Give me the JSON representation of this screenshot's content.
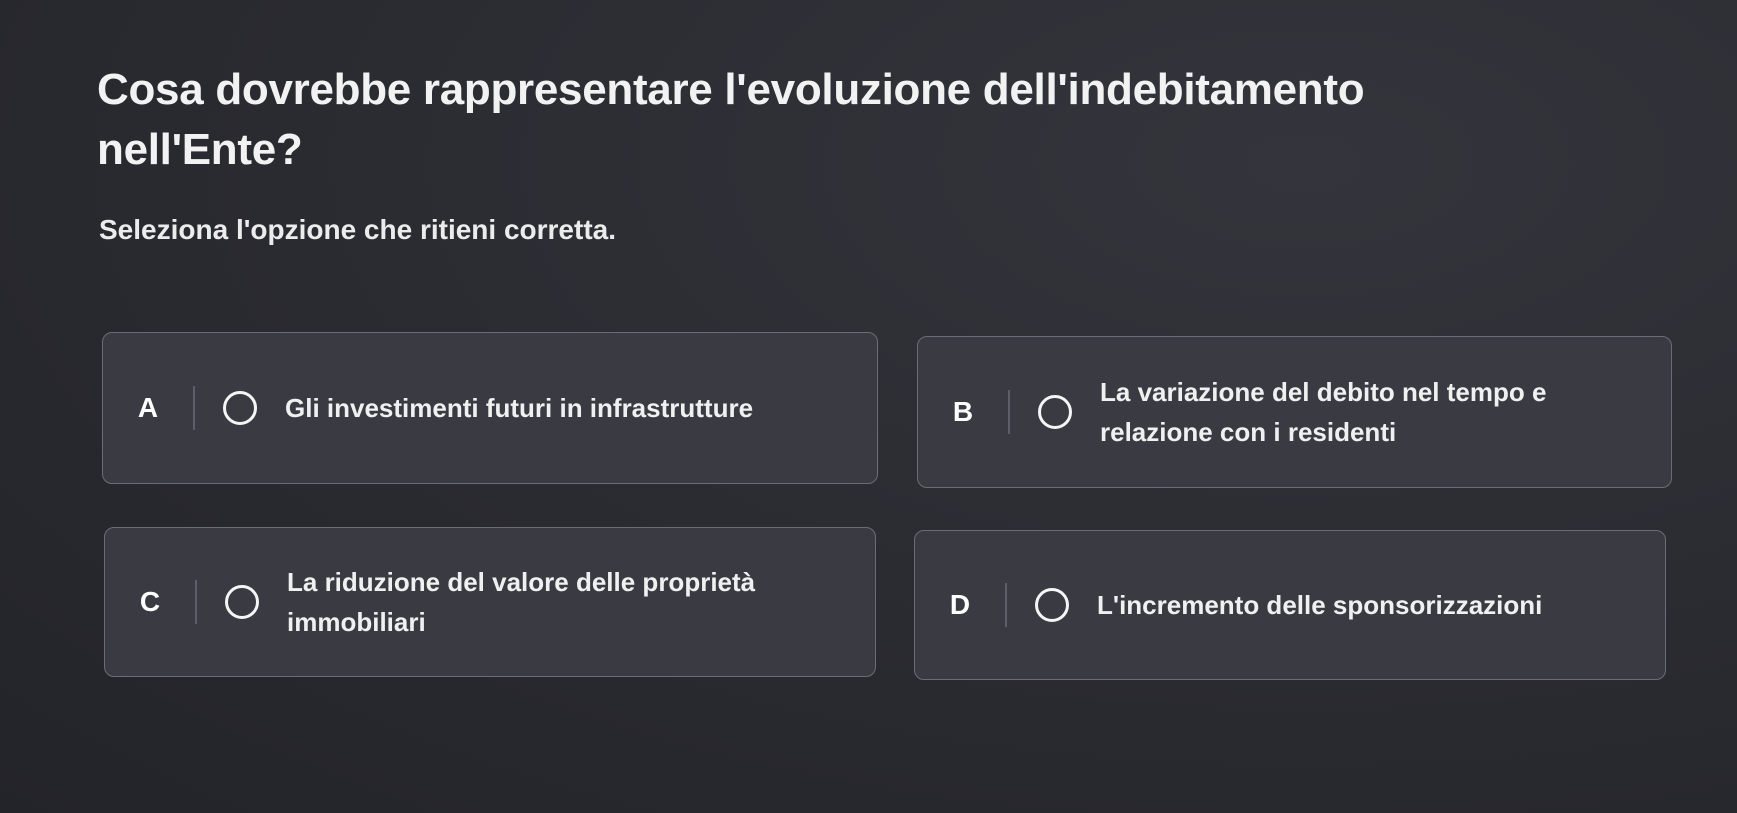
{
  "question": {
    "title": "Cosa dovrebbe rappresentare l'evoluzione dell'indebitamento nell'Ente?",
    "instruction": "Seleziona l'opzione che ritieni corretta."
  },
  "options": [
    {
      "letter": "A",
      "text": "Gli investimenti futuri in infrastrutture",
      "selected": false
    },
    {
      "letter": "B",
      "text": "La variazione del debito nel tempo e relazione con i residenti",
      "selected": false
    },
    {
      "letter": "C",
      "text": "La riduzione del valore delle proprietà immobiliari",
      "selected": false
    },
    {
      "letter": "D",
      "text": "L'incremento delle sponsorizzazioni",
      "selected": false
    }
  ],
  "colors": {
    "background": "#2a2b31",
    "card": "#3a3b42",
    "card_border": "#6b6d76",
    "text": "#ffffff"
  }
}
